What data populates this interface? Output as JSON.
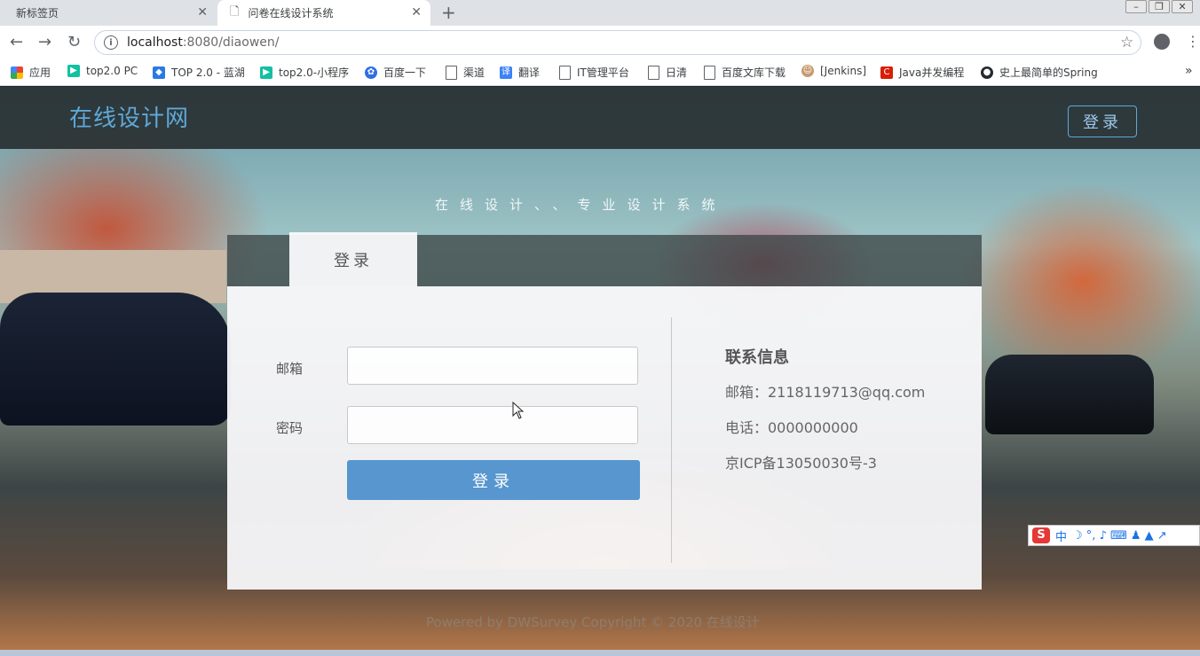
{
  "browser": {
    "tabs": [
      {
        "title": "新标签页",
        "active": false
      },
      {
        "title": "问卷在线设计系统",
        "active": true
      }
    ],
    "new_tab_label": "+",
    "address": {
      "host": "localhost",
      "path": ":8080/diaowen/"
    },
    "bookmarks": [
      {
        "label": "应用",
        "icon": "apps-grid-icon"
      },
      {
        "label": "top2.0 PC",
        "icon": "green-play-icon"
      },
      {
        "label": "TOP 2.0 - 蓝湖",
        "icon": "lanhu-icon"
      },
      {
        "label": "top2.0-小程序",
        "icon": "green-play-icon"
      },
      {
        "label": "百度一下",
        "icon": "baidu-paw-icon"
      },
      {
        "label": "渠道",
        "icon": "page-icon"
      },
      {
        "label": "翻译",
        "icon": "translate-icon"
      },
      {
        "label": "IT管理平台",
        "icon": "page-icon"
      },
      {
        "label": "日清",
        "icon": "page-icon"
      },
      {
        "label": "百度文库下载",
        "icon": "page-icon"
      },
      {
        "label": "[Jenkins]",
        "icon": "jenkins-icon"
      },
      {
        "label": "Java并发编程",
        "icon": "csdn-icon"
      },
      {
        "label": "史上最简单的Spring",
        "icon": "github-icon"
      }
    ],
    "more_label": "»"
  },
  "site": {
    "logo": "在线设计网",
    "top_login": "登录",
    "slogan": "在线设计、、专业设计系统",
    "panel_tab": "登录",
    "form": {
      "email_label": "邮箱",
      "email_value": "",
      "password_label": "密码",
      "password_value": "",
      "submit_label": "登录"
    },
    "contact": {
      "title": "联系信息",
      "email": "邮箱：2118119713@qq.com",
      "phone": "电话：0000000000",
      "icp": "京ICP备13050030号-3"
    },
    "footer": "Powered by DWSurvey    Copyright © 2020 在线设计"
  },
  "ime": {
    "logo": "S",
    "mode": "中",
    "extras": "☽ °, ♪ ⌨ ♟ ▲ ↗"
  },
  "colors": {
    "accent": "#5796cf",
    "logo": "#5fa8d8",
    "header_bg": "#283032"
  }
}
